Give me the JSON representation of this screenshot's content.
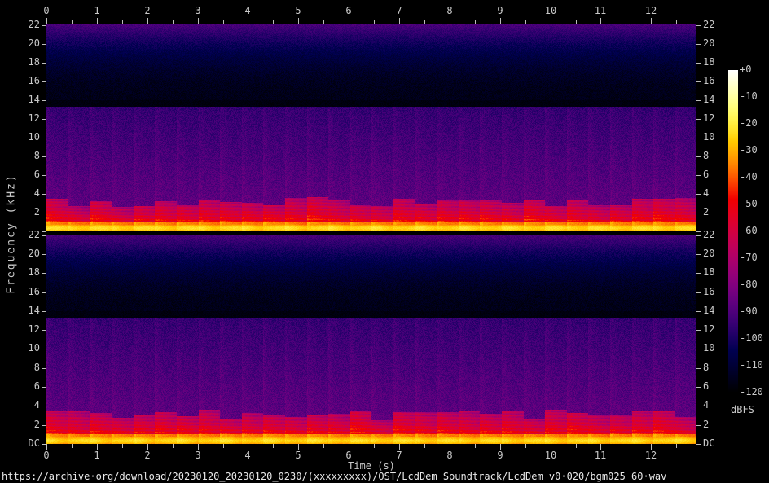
{
  "figure": {
    "footer_url": "https://archive·org/download/20230120_20230120_0230/(xxxxxxxxx)/OST/LcdDem Soundtrack/LcdDem v0·020/bgm025 60·wav"
  },
  "chart_data": {
    "type": "heatmap",
    "subtype": "audio-spectrogram",
    "title": "",
    "xlabel": "Time (s)",
    "ylabel": "Frequency (kHz)",
    "channels": 2,
    "duration_s": 12.9,
    "freq_max_khz": 22.05,
    "time_axis": {
      "major_ticks_s": [
        0,
        1,
        2,
        3,
        4,
        5,
        6,
        7,
        8,
        9,
        10,
        11,
        12
      ],
      "minor_step_s": 0.5
    },
    "freq_axis": {
      "major_tick_khz": [
        22,
        20,
        18,
        16,
        14,
        12,
        10,
        8,
        6,
        4,
        2
      ],
      "dc_label": "DC"
    },
    "colorbar": {
      "label": "dBFS",
      "tick_labels": [
        "+0",
        "-10",
        "-20",
        "-30",
        "-40",
        "-50",
        "-60",
        "-70",
        "-80",
        "-90",
        "-100",
        "-110",
        "-120"
      ],
      "max_db": 0,
      "min_db": -120
    },
    "content": {
      "beat_period_s": 0.43,
      "bands": [
        {
          "name": "dither-noise-near-nyquist",
          "freq_khz": [
            14,
            22.05
          ],
          "level_db_range": [
            -116,
            -92
          ]
        },
        {
          "name": "quiet-gap-above-cutoff",
          "freq_khz": [
            13.3,
            14
          ],
          "level_db_range": [
            -120,
            -114
          ]
        },
        {
          "name": "broadband-noise-floor",
          "freq_khz": [
            3.7,
            13.3
          ],
          "level_db_range": [
            -96,
            -86
          ]
        },
        {
          "name": "rhythmic-harmonic-blocks",
          "freq_khz": [
            0.9,
            3.7
          ],
          "level_db_range": [
            -64,
            -40
          ]
        },
        {
          "name": "bass-fundamental-line",
          "freq_khz": [
            0,
            0.9
          ],
          "level_db_range": [
            -34,
            -20
          ]
        }
      ]
    }
  }
}
